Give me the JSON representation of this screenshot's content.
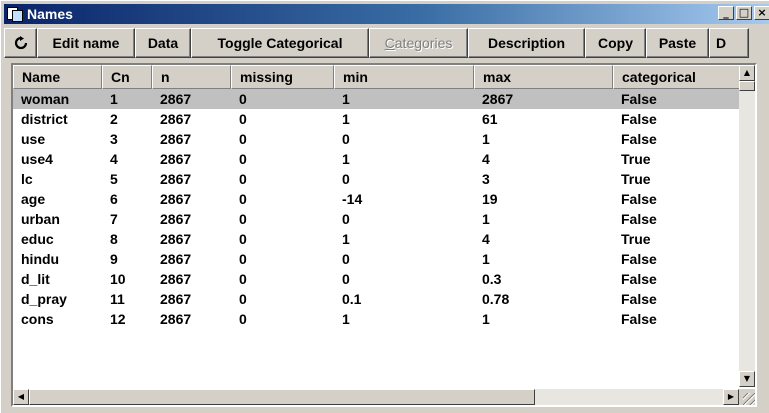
{
  "window": {
    "title": "Names",
    "minimize": "_",
    "maximize": "□",
    "close": "×"
  },
  "toolbar": {
    "refresh_icon": "refresh-icon",
    "buttons": [
      "Edit name",
      "Data",
      "Toggle Categorical",
      "Categories",
      "Description",
      "Copy",
      "Paste",
      "D"
    ],
    "categories_prefix": "C",
    "categories_rest": "ategories",
    "categories_disabled": true
  },
  "table": {
    "columns": [
      "Name",
      "Cn",
      "n",
      "missing",
      "min",
      "max",
      "categorical"
    ],
    "rows": [
      [
        "woman",
        "1",
        "2867",
        "0",
        "1",
        "2867",
        "False"
      ],
      [
        "district",
        "2",
        "2867",
        "0",
        "1",
        "61",
        "False"
      ],
      [
        "use",
        "3",
        "2867",
        "0",
        "0",
        "1",
        "False"
      ],
      [
        "use4",
        "4",
        "2867",
        "0",
        "1",
        "4",
        "True"
      ],
      [
        "lc",
        "5",
        "2867",
        "0",
        "0",
        "3",
        "True"
      ],
      [
        "age",
        "6",
        "2867",
        "0",
        "-14",
        "19",
        "False"
      ],
      [
        "urban",
        "7",
        "2867",
        "0",
        "0",
        "1",
        "False"
      ],
      [
        "educ",
        "8",
        "2867",
        "0",
        "1",
        "4",
        "True"
      ],
      [
        "hindu",
        "9",
        "2867",
        "0",
        "0",
        "1",
        "False"
      ],
      [
        "d_lit",
        "10",
        "2867",
        "0",
        "0",
        "0.3",
        "False"
      ],
      [
        "d_pray",
        "11",
        "2867",
        "0",
        "0.1",
        "0.78",
        "False"
      ],
      [
        "cons",
        "12",
        "2867",
        "0",
        "1",
        "1",
        "False"
      ]
    ],
    "selected_row": 0
  },
  "scrollbars": {
    "up_arrow": "▲",
    "down_arrow": "▼",
    "left_arrow": "◀",
    "right_arrow": "▶"
  }
}
